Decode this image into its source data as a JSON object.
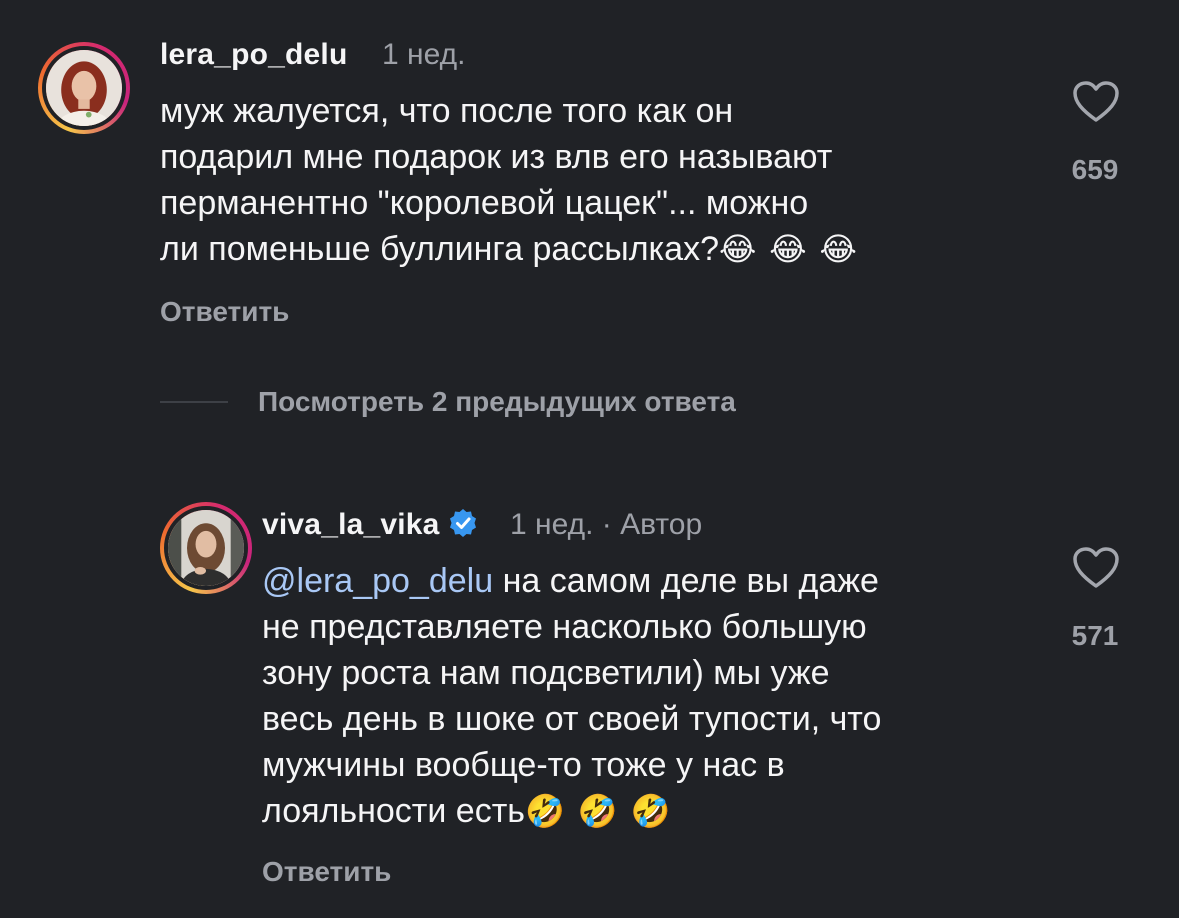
{
  "comments": [
    {
      "username": "lera_po_delu",
      "time": "1 нед.",
      "text": "муж жалуется, что после того как он\nподарил мне подарок из влв его называют\nперманентно \"королевой цацек\"... можно\nли поменьше буллинга рассылках?",
      "emojis": "😂 😂 😂",
      "reply_label": "Ответить",
      "likes": "659"
    }
  ],
  "view_replies": {
    "label": "Посмотреть 2 предыдущих ответа"
  },
  "reply": {
    "username": "viva_la_vika",
    "time": "1 нед. · Автор",
    "mention": "@lera_po_delu",
    "text_first_line": " на самом деле вы даже",
    "text_rest": "не представляете насколько большую\nзону роста нам подсветили) мы уже\nвесь день в шоке от своей тупости, что\nмужчины вообще-то тоже у нас в\nлояльности есть",
    "emojis": "🤣 🤣 🤣",
    "reply_label": "Ответить",
    "likes": "571"
  },
  "colors": {
    "background": "#202226",
    "primary_text": "#f5f5f6",
    "secondary_text": "#9ea1a8",
    "mention": "#a9c8f5",
    "verified_badge": "#3897f0"
  }
}
